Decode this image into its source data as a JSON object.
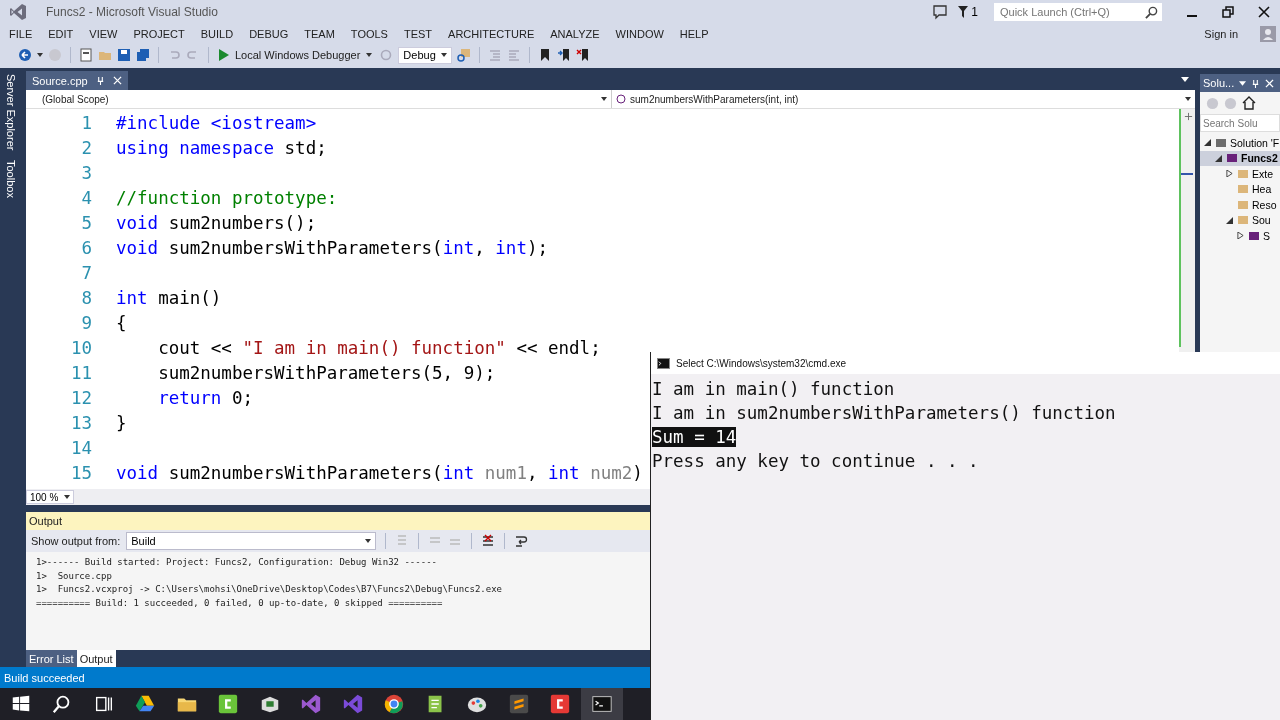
{
  "window": {
    "title": "Funcs2 - Microsoft Visual Studio"
  },
  "titlebar": {
    "notification_count": "1",
    "quick_launch": {
      "placeholder": "Quick Launch (Ctrl+Q)"
    }
  },
  "menu": [
    "FILE",
    "EDIT",
    "VIEW",
    "PROJECT",
    "BUILD",
    "DEBUG",
    "TEAM",
    "TOOLS",
    "TEST",
    "ARCHITECTURE",
    "ANALYZE",
    "WINDOW",
    "HELP"
  ],
  "sign_in": "Sign in",
  "toolbar": {
    "run_button": "Local Windows Debugger",
    "configuration": "Debug"
  },
  "side_tabs": [
    "Server Explorer",
    "Toolbox"
  ],
  "document_tabs": [
    {
      "label": "Source.cpp",
      "selected": true
    }
  ],
  "navigation": {
    "scope": "(Global Scope)",
    "member": "sum2numbersWithParameters(int, int)"
  },
  "code_lines": [
    {
      "number": "1",
      "tokens": [
        {
          "kind": "keyword",
          "text": "#include <iostream>"
        }
      ]
    },
    {
      "number": "2",
      "tokens": [
        {
          "kind": "keyword",
          "text": "using namespace"
        },
        {
          "kind": "plain",
          "text": " std;"
        }
      ]
    },
    {
      "number": "3"
    },
    {
      "number": "4",
      "tokens": [
        {
          "kind": "comment",
          "text": "//function prototype:"
        }
      ]
    },
    {
      "number": "5",
      "tokens": [
        {
          "kind": "keyword",
          "text": "void"
        },
        {
          "kind": "plain",
          "text": " sum2numbers();"
        }
      ]
    },
    {
      "number": "6",
      "tokens": [
        {
          "kind": "keyword",
          "text": "void"
        },
        {
          "kind": "plain",
          "text": " sum2numbersWithParameters("
        },
        {
          "kind": "keyword",
          "text": "int"
        },
        {
          "kind": "plain",
          "text": ", "
        },
        {
          "kind": "keyword",
          "text": "int"
        },
        {
          "kind": "plain",
          "text": ");"
        }
      ]
    },
    {
      "number": "7"
    },
    {
      "number": "8",
      "tokens": [
        {
          "kind": "keyword",
          "text": "int"
        },
        {
          "kind": "plain",
          "text": " main()"
        }
      ]
    },
    {
      "number": "9",
      "tokens": [
        {
          "kind": "plain",
          "text": "{"
        }
      ]
    },
    {
      "number": "10",
      "tokens": [
        {
          "kind": "plain",
          "text": "    cout << "
        },
        {
          "kind": "string",
          "text": "\"I am in main() function\""
        },
        {
          "kind": "plain",
          "text": " << endl;"
        }
      ]
    },
    {
      "number": "11",
      "tokens": [
        {
          "kind": "plain",
          "text": "    sum2numbersWithParameters(5, 9);"
        }
      ]
    },
    {
      "number": "12",
      "tokens": [
        {
          "kind": "keyword",
          "text": "    return"
        },
        {
          "kind": "plain",
          "text": " 0;"
        }
      ]
    },
    {
      "number": "13",
      "tokens": [
        {
          "kind": "plain",
          "text": "}"
        }
      ]
    },
    {
      "number": "14"
    },
    {
      "number": "15",
      "tokens": [
        {
          "kind": "keyword",
          "text": "void"
        },
        {
          "kind": "plain",
          "text": " sum2numbersWithParameters("
        },
        {
          "kind": "keyword",
          "text": "int"
        },
        {
          "kind": "param",
          "text": " num1"
        },
        {
          "kind": "plain",
          "text": ", "
        },
        {
          "kind": "keyword",
          "text": "int"
        },
        {
          "kind": "param",
          "text": " num2"
        },
        {
          "kind": "plain",
          "text": ")"
        }
      ]
    }
  ],
  "zoom_level": "100 %",
  "output": {
    "title": "Output",
    "source_label": "Show output from:",
    "source": "Build",
    "lines": [
      "1>------ Build started: Project: Funcs2, Configuration: Debug Win32 ------",
      "1>  Source.cpp",
      "1>  Funcs2.vcxproj -> C:\\Users\\mohsi\\OneDrive\\Desktop\\Codes\\B7\\Funcs2\\Debug\\Funcs2.exe",
      "========== Build: 1 succeeded, 0 failed, 0 up-to-date, 0 skipped =========="
    ]
  },
  "bottom_tabs": [
    {
      "label": "Error List",
      "selected": false
    },
    {
      "label": "Output",
      "selected": true
    }
  ],
  "solution_explorer": {
    "title": "Solu...",
    "search": {
      "placeholder": "Search Solu"
    },
    "tree": [
      {
        "label": "Solution 'F",
        "kind": "solution",
        "expanded": true,
        "selected": false,
        "children": [
          {
            "label": "Funcs2",
            "kind": "project",
            "expanded": true,
            "selected": true,
            "children": [
              {
                "label": "Exte",
                "kind": "folder",
                "expanded": false,
                "selected": false
              },
              {
                "label": "Hea",
                "kind": "folder",
                "selected": false
              },
              {
                "label": "Reso",
                "kind": "folder",
                "selected": false
              },
              {
                "label": "Sou",
                "kind": "folder",
                "expanded": true,
                "selected": false,
                "children": [
                  {
                    "label": "S",
                    "kind": "file",
                    "expanded": false,
                    "selected": false
                  }
                ]
              }
            ]
          }
        ]
      }
    ]
  },
  "status_bar": {
    "text": "Build succeeded"
  },
  "taskbar": [
    {
      "kind": "start",
      "selected": false
    },
    {
      "kind": "search",
      "selected": false
    },
    {
      "kind": "taskview",
      "selected": false
    },
    {
      "kind": "drive",
      "selected": false
    },
    {
      "kind": "folder",
      "selected": false
    },
    {
      "kind": "camtasia",
      "selected": false
    },
    {
      "kind": "app",
      "selected": false
    },
    {
      "kind": "vs",
      "selected": false
    },
    {
      "kind": "vs2",
      "selected": false
    },
    {
      "kind": "chrome",
      "selected": false
    },
    {
      "kind": "notepad",
      "selected": false
    },
    {
      "kind": "paint",
      "selected": false
    },
    {
      "kind": "sublime",
      "selected": false
    },
    {
      "kind": "recorder",
      "selected": false
    },
    {
      "kind": "console",
      "selected": true
    }
  ],
  "console": {
    "title": "Select C:\\Windows\\system32\\cmd.exe",
    "lines": [
      {
        "text": "I am in main() function",
        "selected": false
      },
      {
        "text": "I am in sum2numbersWithParameters() function",
        "selected": false
      },
      {
        "text": "Sum = 14",
        "selected": true
      },
      {
        "text": "Press any key to continue . . .",
        "selected": false
      }
    ]
  }
}
